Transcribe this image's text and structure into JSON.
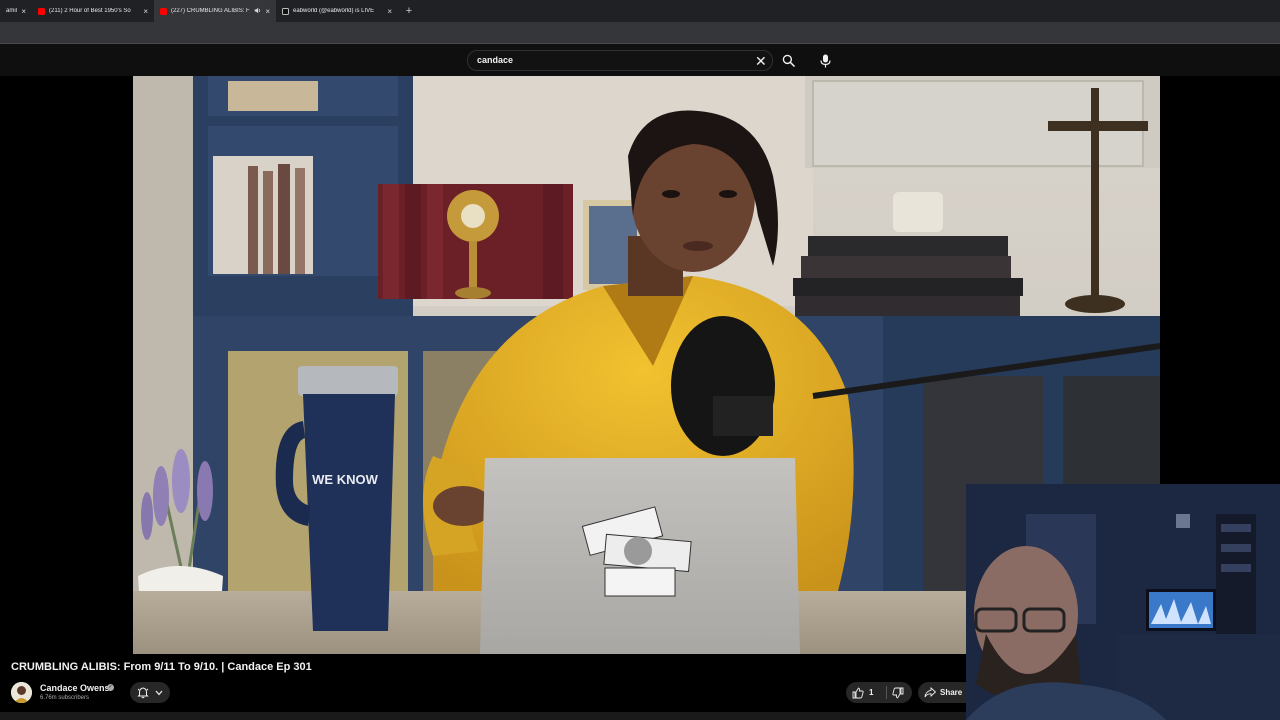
{
  "browser": {
    "tabs": [
      {
        "title": "amil",
        "favicon": "none",
        "active": false
      },
      {
        "title": "(211) 2 Hour of Best 1950's So",
        "favicon": "youtube",
        "active": false
      },
      {
        "title": "(227) CRUMBLING ALIBIS: F",
        "favicon": "youtube",
        "active": true,
        "audio": true
      },
      {
        "title": "eabworld (@eabworld) is LIVE",
        "favicon": "tiktok",
        "active": false
      }
    ],
    "close_glyph": "×",
    "new_tab_glyph": "+"
  },
  "search": {
    "query": "candace",
    "clear_glyph": "✕"
  },
  "video": {
    "title": "CRUMBLING ALIBIS: From 9/11 To 9/10. | Candace Ep 301",
    "mug_text": "WE KNOW"
  },
  "channel": {
    "name": "Candace Owens",
    "subscribers": "6.76m subscribers"
  },
  "actions": {
    "like_count": "1",
    "share_label": "Share"
  },
  "colors": {
    "accent": "#ff0000",
    "background": "#0f0f0f",
    "chip": "#272727"
  }
}
